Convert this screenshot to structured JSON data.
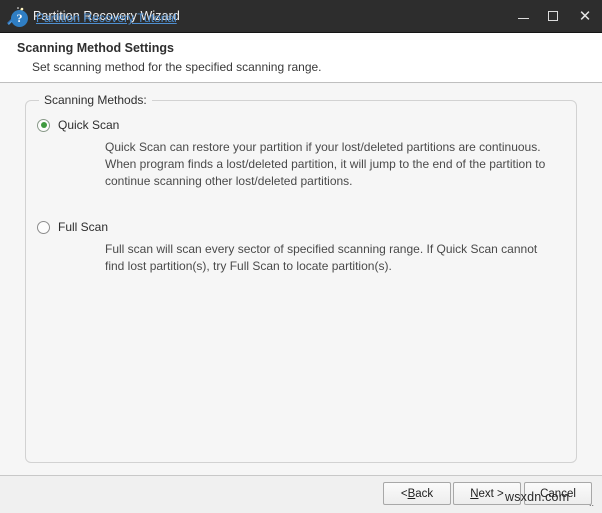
{
  "window": {
    "title": "Partition Recovery Wizard",
    "app_icon": "wizard-wand-icon",
    "controls": {
      "minimize": "minimize-icon",
      "maximize": "maximize-icon",
      "close": "✕"
    }
  },
  "header": {
    "title": "Scanning Method Settings",
    "subtitle": "Set scanning method for the specified scanning range."
  },
  "group": {
    "legend": "Scanning Methods:",
    "options": [
      {
        "label": "Quick Scan",
        "selected": true,
        "description": "Quick Scan can restore your partition if your lost/deleted partitions are continuous. When program finds a lost/deleted partition, it will jump to the end of the partition to continue scanning other lost/deleted partitions."
      },
      {
        "label": "Full Scan",
        "selected": false,
        "description": "Full scan will scan every sector of specified scanning range. If Quick Scan cannot find lost partition(s), try Full Scan to locate partition(s)."
      }
    ]
  },
  "footer": {
    "help_icon": "?",
    "tutorial_link": "Partition Recovery Tutorial",
    "buttons": {
      "back_pre": "< ",
      "back_mnemonic": "B",
      "back_post": "ack",
      "next_pre": "",
      "next_mnemonic": "N",
      "next_post": "ext >",
      "cancel": "Cancel"
    }
  },
  "watermark": {
    "text": "wsxdn.com",
    "dots": ".."
  },
  "colors": {
    "titlebar": "#2d2d2d",
    "accent_link": "#4f8fd0",
    "radio_dot": "#3f9a3f",
    "help_badge": "#2f7ec4"
  }
}
